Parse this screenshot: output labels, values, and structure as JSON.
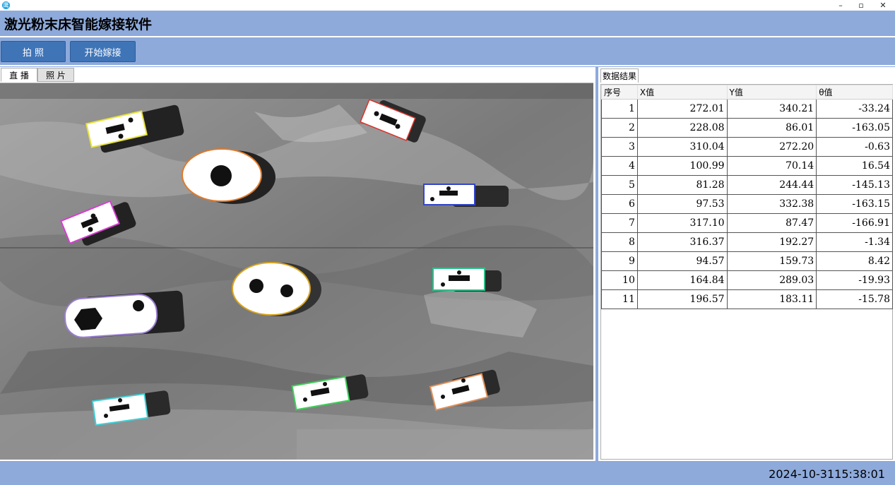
{
  "window": {
    "icon_glyph": "鹰",
    "minimize_glyph": "–",
    "restore_glyph": "▫",
    "close_glyph": "✕"
  },
  "header": {
    "title": "激光粉末床智能嫁接软件"
  },
  "toolbar": {
    "capture_label": "拍 照",
    "start_label": "开始嫁接"
  },
  "view_tabs": [
    {
      "label": "直 播"
    },
    {
      "label": "照 片"
    }
  ],
  "results": {
    "group_title": "数据结果",
    "columns": [
      "序号",
      "X值",
      "Y值",
      "θ值"
    ],
    "rows": [
      [
        "1",
        "272.01",
        "340.21",
        "-33.24"
      ],
      [
        "2",
        "228.08",
        "86.01",
        "-163.05"
      ],
      [
        "3",
        "310.04",
        "272.20",
        "-0.63"
      ],
      [
        "4",
        "100.99",
        "70.14",
        "16.54"
      ],
      [
        "5",
        "81.28",
        "244.44",
        "-145.13"
      ],
      [
        "6",
        "97.53",
        "332.38",
        "-163.15"
      ],
      [
        "7",
        "317.10",
        "87.47",
        "-166.91"
      ],
      [
        "8",
        "316.37",
        "192.27",
        "-1.34"
      ],
      [
        "9",
        "94.57",
        "159.73",
        "8.42"
      ],
      [
        "10",
        "164.84",
        "289.03",
        "-19.93"
      ],
      [
        "11",
        "196.57",
        "183.11",
        "-15.78"
      ]
    ]
  },
  "status": {
    "datetime": "2024-10-3115:38:01"
  },
  "colors": {
    "accent": "#3f74b7",
    "frame": "#8eaadb",
    "box_yellow": "#e8e23a",
    "box_red": "#d9342c",
    "box_orange": "#e07a2a",
    "box_blue": "#3345c8",
    "box_magenta": "#d53fd0",
    "box_teal": "#2bbf88",
    "box_violet": "#9a7fd0",
    "box_gold": "#d9a520",
    "box_cyan": "#3fd0d8",
    "box_green": "#3fcf5a",
    "box_salmon": "#e0905a"
  }
}
